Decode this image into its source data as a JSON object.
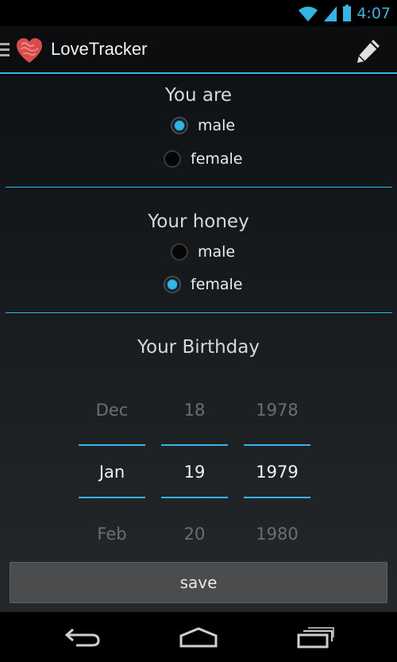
{
  "status_bar": {
    "time": "4:07",
    "icons": [
      "wifi-icon",
      "signal-icon",
      "battery-icon"
    ]
  },
  "action_bar": {
    "title": "LoveTracker",
    "icons": [
      "menu-icon",
      "heart-logo-icon",
      "pencil-icon"
    ]
  },
  "you_are": {
    "title": "You are",
    "options": [
      {
        "label": "male",
        "checked": true
      },
      {
        "label": "female",
        "checked": false
      }
    ]
  },
  "your_honey": {
    "title": "Your honey",
    "options": [
      {
        "label": "male",
        "checked": false
      },
      {
        "label": "female",
        "checked": true
      }
    ]
  },
  "birthday": {
    "title": "Your Birthday",
    "month": {
      "prev": "Dec",
      "current": "Jan",
      "next": "Feb"
    },
    "day": {
      "prev": "18",
      "current": "19",
      "next": "20"
    },
    "year": {
      "prev": "1978",
      "current": "1979",
      "next": "1980"
    }
  },
  "save_label": "save",
  "nav_bar": {
    "icons": [
      "back-icon",
      "home-icon",
      "recents-icon"
    ]
  },
  "colors": {
    "accent": "#33b5e5",
    "background_top": "#0f1214",
    "background_bottom": "#24282c",
    "button": "#4a4c4e"
  }
}
